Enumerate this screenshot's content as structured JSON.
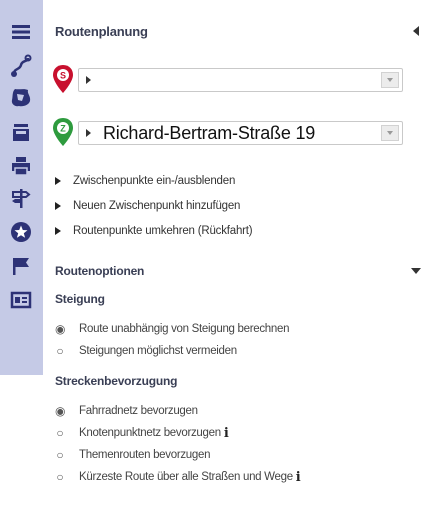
{
  "sidebar": {
    "items": [
      {
        "name": "menu-icon"
      },
      {
        "name": "route-icon"
      },
      {
        "name": "map-icon"
      },
      {
        "name": "tool-icon"
      },
      {
        "name": "print-icon"
      },
      {
        "name": "signpost-icon"
      },
      {
        "name": "star-icon"
      },
      {
        "name": "flag-icon"
      },
      {
        "name": "panel-icon"
      }
    ],
    "colors": {
      "background": "#c5cae6",
      "icons": "#2d3276"
    }
  },
  "panel": {
    "title": "Routenplanung",
    "start": {
      "pin_label": "S",
      "pin_color": "#c8102e",
      "value": ""
    },
    "destination": {
      "pin_label": "Z",
      "pin_color": "#2e9b3e",
      "value": "Richard-Bertram-Straße 19"
    },
    "links": [
      {
        "label": "Zwischenpunkte ein-/ausblenden"
      },
      {
        "label": "Neuen Zwischenpunkt hinzufügen"
      },
      {
        "label": "Routenpunkte umkehren (Rückfahrt)"
      }
    ]
  },
  "options": {
    "title": "Routenoptionen",
    "slope": {
      "title": "Steigung",
      "choices": [
        {
          "label": "Route unabhängig von Steigung berechnen",
          "selected": true
        },
        {
          "label": "Steigungen möglichst vermeiden",
          "selected": false
        }
      ]
    },
    "preference": {
      "title": "Streckenbevorzugung",
      "choices": [
        {
          "label": "Fahrradnetz bevorzugen",
          "selected": true,
          "info": ""
        },
        {
          "label": "Knotenpunktnetz bevorzugen",
          "selected": false,
          "info": "i"
        },
        {
          "label": "Themenrouten bevorzugen",
          "selected": false,
          "info": ""
        },
        {
          "label": "Kürzeste Route über alle Straßen und Wege",
          "selected": false,
          "info": "i"
        }
      ]
    }
  }
}
